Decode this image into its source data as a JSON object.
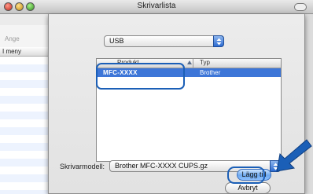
{
  "window": {
    "title": "Skrivarlista"
  },
  "background": {
    "ange_label": "Ange",
    "meny_label": "I meny"
  },
  "dialog": {
    "connection_popup": {
      "value": "USB"
    },
    "list": {
      "columns": [
        "Produkt",
        "Typ"
      ],
      "rows": [
        {
          "product": "MFC-XXXX",
          "type": "Brother",
          "selected": true
        }
      ]
    },
    "model_label": "Skrivarmodell:",
    "model_popup": {
      "value": "Brother MFC-XXXX CUPS.gz"
    },
    "cancel_label": "Avbryt",
    "add_label": "Lägg till"
  },
  "colors": {
    "selection": "#3d76d8",
    "highlight": "#1b5fb7",
    "default_button": "#6ea9ef"
  },
  "icons": [
    "close-icon",
    "minimize-icon",
    "zoom-icon",
    "popup-arrows-icon",
    "sort-arrow-icon",
    "pointer-arrow-icon"
  ]
}
